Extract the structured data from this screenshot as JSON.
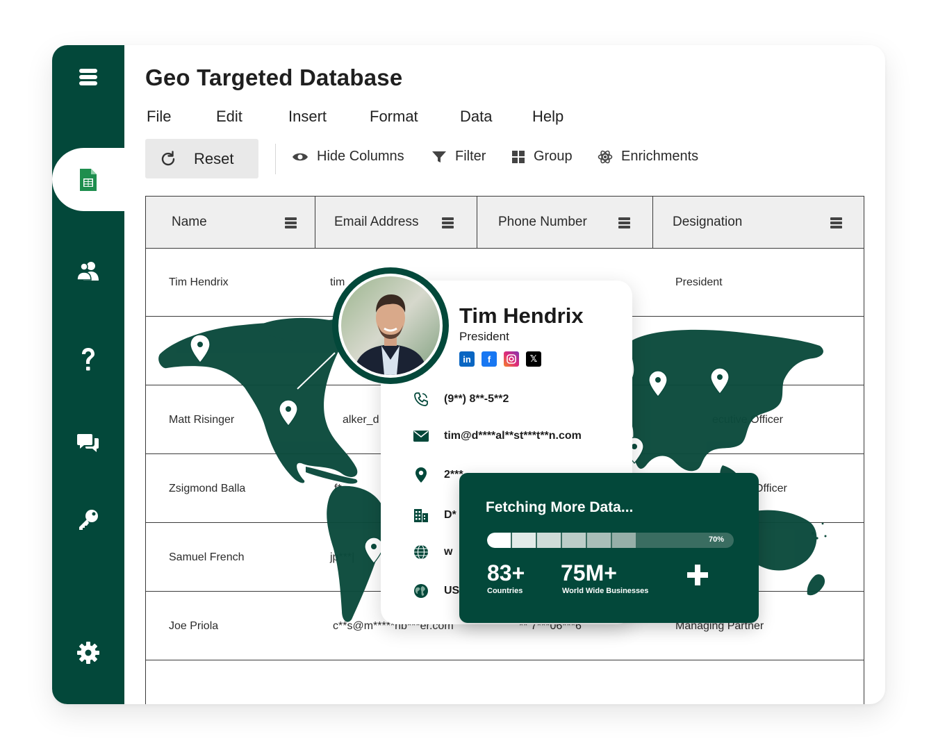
{
  "sidebar": {
    "items": [
      {
        "icon": "database-icon"
      },
      {
        "icon": "spreadsheet-icon",
        "active": true
      },
      {
        "icon": "users-icon"
      },
      {
        "icon": "question-icon"
      },
      {
        "icon": "chat-icon"
      },
      {
        "icon": "key-icon"
      },
      {
        "icon": "gear-icon"
      }
    ],
    "color": "#03483a"
  },
  "header": {
    "title": "Geo Targeted Database"
  },
  "menu": [
    "File",
    "Edit",
    "Insert",
    "Format",
    "Data",
    "Help"
  ],
  "toolbar": {
    "reset_label": "Reset",
    "hide_columns_label": "Hide Columns",
    "filter_label": "Filter",
    "group_label": "Group",
    "enrichments_label": "Enrichments"
  },
  "table": {
    "columns": [
      "Name",
      "Email Address",
      "Phone Number",
      "Designation"
    ],
    "rows": [
      {
        "name": "Tim Hendrix",
        "email": "tim",
        "phone": "",
        "designation": "President"
      },
      {
        "name": "",
        "email": "",
        "phone": "",
        "designation": ""
      },
      {
        "name": "Matt Risinger",
        "email": "alker_d",
        "phone": "",
        "designation": "ecutive Officer"
      },
      {
        "name": "Zsigmond Balla",
        "email": "f*",
        "phone": "",
        "designation": "Officer"
      },
      {
        "name": "Samuel French",
        "email": "jp***|",
        "phone": "",
        "designation": ""
      },
      {
        "name": "Joe Priola",
        "email": "c**s@m*****nb***er.com",
        "phone": "** 7***06***6",
        "designation": "Managing Partner"
      }
    ]
  },
  "profile": {
    "name": "Tim Hendrix",
    "title": "President",
    "socials": [
      "linkedin-icon",
      "facebook-icon",
      "instagram-icon",
      "x-icon"
    ],
    "phone": "(9**) 8**-5**2",
    "email": "tim@d****al**st***t**n.com",
    "address": "2***",
    "company": "D*",
    "website": "w",
    "country": "US"
  },
  "fetch": {
    "title": "Fetching More Data...",
    "progress": 0.7,
    "progress_label": "70%",
    "stat1_value": "83+",
    "stat1_label": "Countries",
    "stat2_value": "75M+",
    "stat2_label": "World Wide Businesses"
  },
  "colors": {
    "brand": "#03483a",
    "map": "#0b4a3c"
  }
}
